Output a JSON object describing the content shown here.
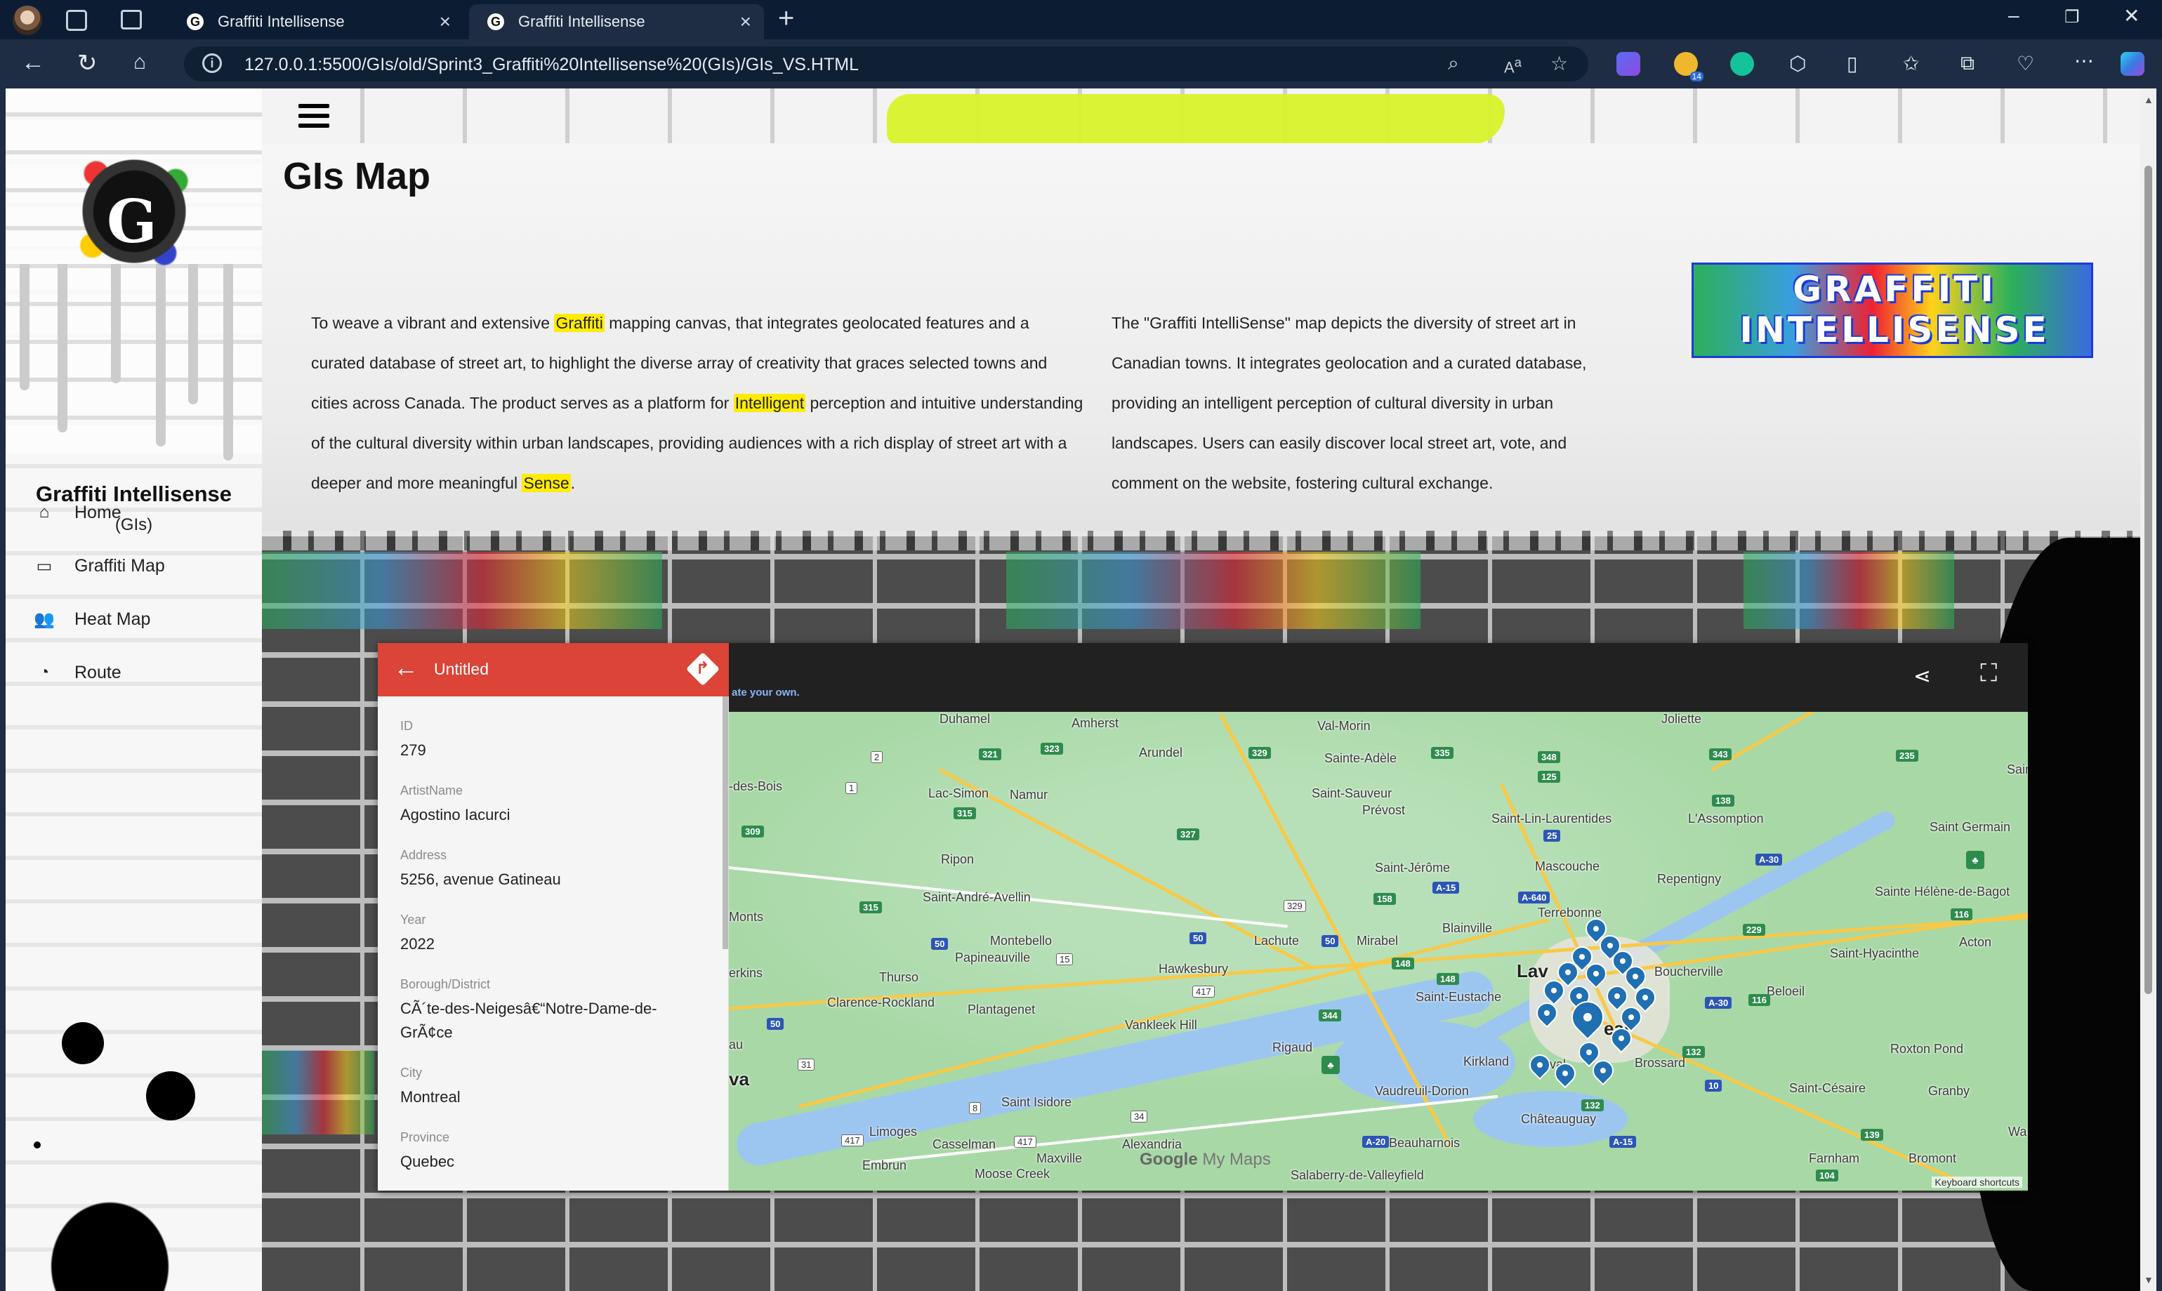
{
  "browser": {
    "tabs": [
      {
        "title": "Graffiti Intellisense",
        "favicon": "G"
      },
      {
        "title": "Graffiti Intellisense",
        "favicon": "G"
      }
    ],
    "active_tab": 1,
    "url": "127.0.0.1:5500/GIs/old/Sprint3_Graffiti%20Intellisense%20(GIs)/GIs_VS.HTML",
    "extension_badge": "14"
  },
  "sidebar": {
    "brand_title": "Graffiti Intellisense",
    "brand_sub": "(GIs)",
    "logo_letter": "G",
    "items": [
      {
        "label": "Home",
        "icon": "home-icon"
      },
      {
        "label": "Graffiti Map",
        "icon": "monitor-icon"
      },
      {
        "label": "Heat Map",
        "icon": "users-icon"
      },
      {
        "label": "Route",
        "icon": "dashboard-icon"
      }
    ]
  },
  "main": {
    "title": "GIs Map",
    "para1": {
      "parts": [
        "To weave a vibrant and extensive ",
        "Graffiti",
        " mapping canvas, that integrates geolocated features and a curated database of street art, to highlight the diverse array of creativity that graces selected towns and cities across Canada. The product serves as a platform for ",
        "Intelligent",
        " perception and intuitive understanding of the cultural diversity within urban landscapes, providing audiences with a rich display of street art with a deeper and more meaningful ",
        "Sense",
        "."
      ]
    },
    "para2": "The \"Graffiti IntelliSense\" map depicts the diversity of street art in Canadian towns. It integrates geolocation and a curated database, providing an intelligent perception of cultural diversity in urban landscapes. Users can easily discover local street art, vote, and comment on the website, fostering cultural exchange.",
    "banner_text": "GRAFFITI INTELLISENSE",
    "highlight_color": "#ffec00"
  },
  "map_embed": {
    "header_hint": "ate your own.",
    "panel": {
      "title": "Untitled",
      "fields": [
        {
          "label": "ID",
          "value": "279"
        },
        {
          "label": "ArtistName",
          "value": "Agostino Iacurci"
        },
        {
          "label": "Address",
          "value": "5256, avenue Gatineau"
        },
        {
          "label": "Year",
          "value": "2022"
        },
        {
          "label": "Borough/District",
          "value": "CÃ´te-des-Neigesâ€“Notre-Dame-de-GrÃ¢ce"
        },
        {
          "label": "City",
          "value": "Montreal"
        },
        {
          "label": "Province",
          "value": "Quebec"
        }
      ]
    },
    "places": [
      "Duhamel",
      "Amherst",
      "Val-Morin",
      "Joliette",
      "Arundel",
      "Sainte-Adèle",
      "-des-Bois",
      "Lac-Simon",
      "Namur",
      "Saint-Sauveur",
      "Prévost",
      "Saint-Lin-Laurentides",
      "L'Assomption",
      "Saint Germain",
      "Ripon",
      "Saint-Jérôme",
      "Mascouche",
      "Repentigny",
      "Saint-André-Avellin",
      "Terrebonne",
      "Sainte Hélène-de-Bagot",
      "Monts",
      "Montebello",
      "Lachute",
      "Mirabel",
      "Blainville",
      "Papineauville",
      "Hawkesbury",
      "Thurso",
      "Lav",
      "Boucherville",
      "Saint-Hyacinthe",
      "Acton",
      "erkins",
      "Clarence-Rockland",
      "Plantagenet",
      "Saint-Eustache",
      "Beloeil",
      "Vankleek Hill",
      "Rigaud",
      "eal",
      "au",
      "Kirkland",
      "Dorval",
      "Brossard",
      "Roxton Pond",
      "va",
      "Vaudreuil-Dorion",
      "Saint Isidore",
      "Saint-Césaire",
      "Granby",
      "Limoges",
      "Châteauguay",
      "Casselman",
      "Maxville",
      "Alexandria",
      "Beauharnois",
      "Farnham",
      "Bromont",
      "Embrun",
      "Moose Creek",
      "Salaberry-de-Valleyfield",
      "Sain",
      "Wa"
    ],
    "google_label": "Google",
    "mymaps_label": "My Maps",
    "keyboard_label": "Keyboard shortcuts"
  }
}
